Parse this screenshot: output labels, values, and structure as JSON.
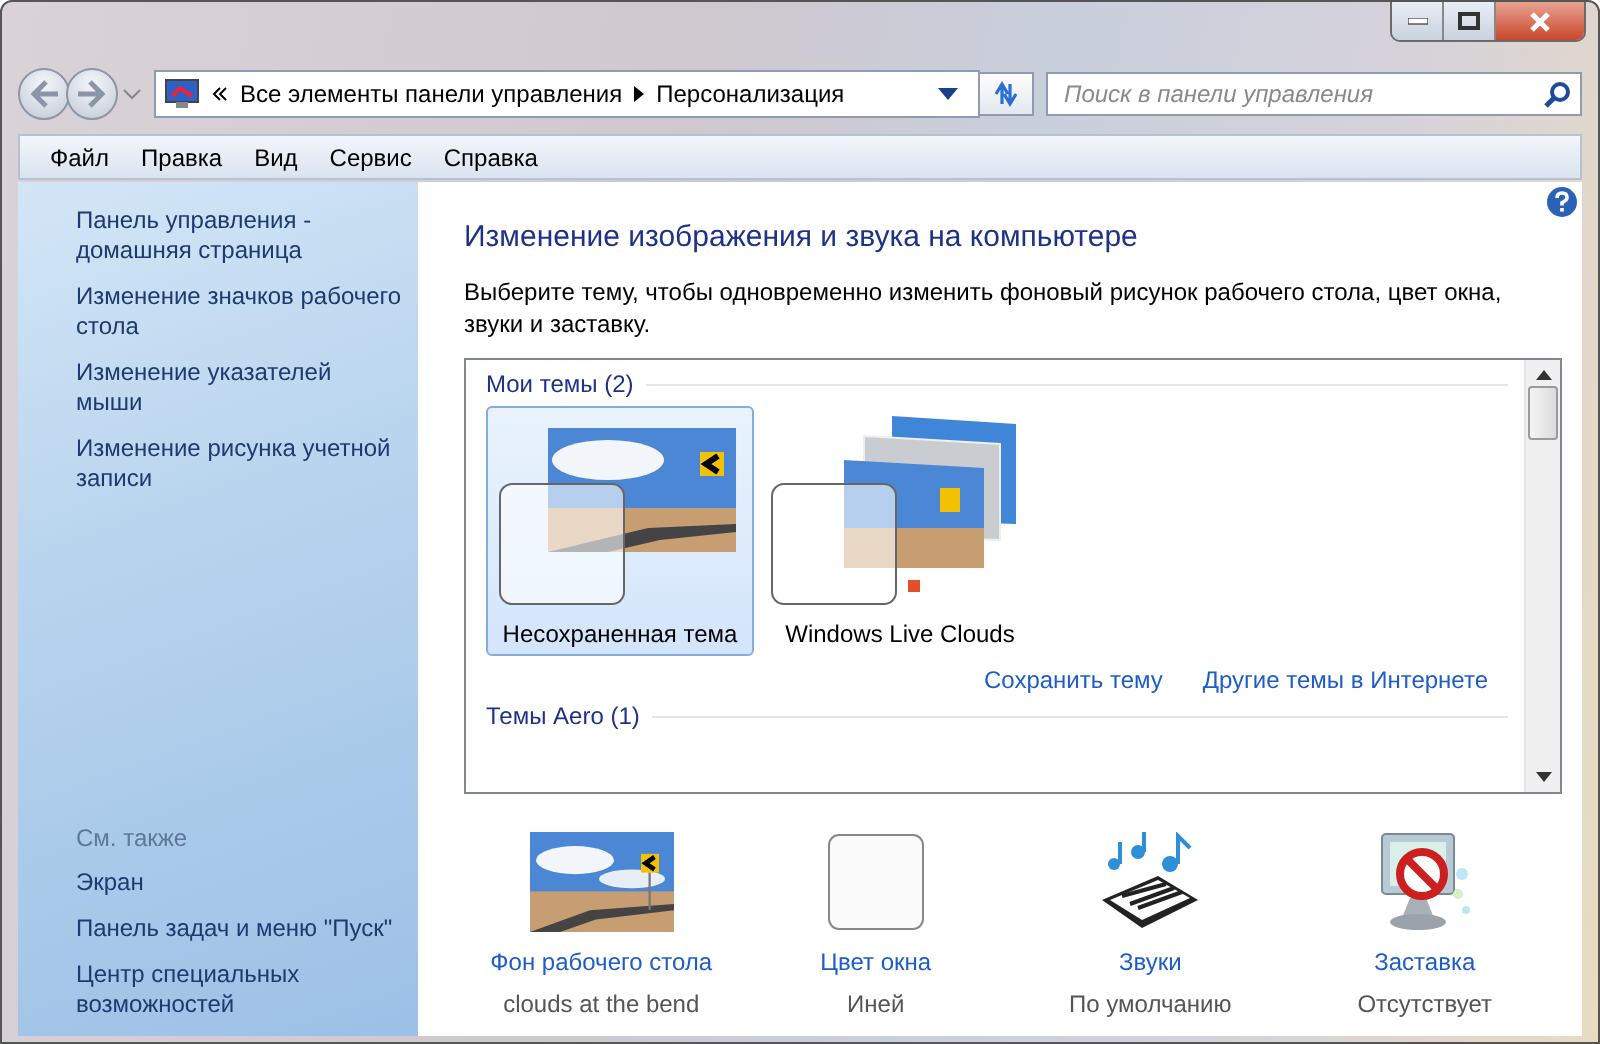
{
  "address_bar": {
    "breadcrumbs": [
      "Все элементы панели управления",
      "Персонализация"
    ]
  },
  "search": {
    "placeholder": "Поиск в панели управления"
  },
  "menu": [
    "Файл",
    "Правка",
    "Вид",
    "Сервис",
    "Справка"
  ],
  "sidebar": {
    "items": [
      "Панель управления - домашняя страница",
      "Изменение значков рабочего стола",
      "Изменение указателей мыши",
      "Изменение рисунка учетной записи"
    ],
    "see_also": {
      "title": "См. также",
      "items": [
        "Экран",
        "Панель задач и меню \"Пуск\"",
        "Центр специальных возможностей"
      ]
    }
  },
  "content": {
    "title": "Изменение изображения и звука на компьютере",
    "description": "Выберите тему, чтобы одновременно изменить фоновый рисунок рабочего стола, цвет окна, звуки и заставку.",
    "sections": [
      {
        "title": "Мои темы (2)",
        "themes": [
          {
            "name": "Несохраненная тема",
            "kind": "single",
            "selected": true
          },
          {
            "name": "Windows Live Clouds",
            "kind": "stack",
            "selected": false
          }
        ],
        "links": [
          "Сохранить тему",
          "Другие темы в Интернете"
        ]
      },
      {
        "title": "Темы Aero (1)"
      }
    ]
  },
  "settings": [
    {
      "kind": "background",
      "label": "Фон рабочего стола",
      "value": "clouds at the bend"
    },
    {
      "kind": "color",
      "label": "Цвет окна",
      "value": "Иней"
    },
    {
      "kind": "sounds",
      "label": "Звуки",
      "value": "По умолчанию"
    },
    {
      "kind": "screensaver",
      "label": "Заставка",
      "value": "Отсутствует"
    }
  ]
}
